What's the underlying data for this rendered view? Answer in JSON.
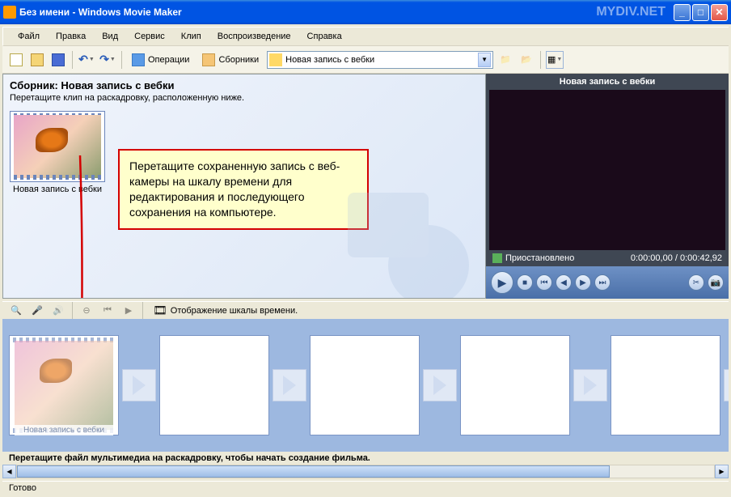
{
  "window": {
    "title": "Без имени - Windows Movie Maker",
    "watermark": "MYDIV.NET"
  },
  "menu": [
    "Файл",
    "Правка",
    "Вид",
    "Сервис",
    "Клип",
    "Воспроизведение",
    "Справка"
  ],
  "toolbar": {
    "tasks": "Операции",
    "collections": "Сборники",
    "dropdown_value": "Новая запись с вебки"
  },
  "collection": {
    "title": "Сборник: Новая запись с вебки",
    "subtitle": "Перетащите клип на раскадровку, расположенную ниже.",
    "clip_name": "Новая запись с вебки"
  },
  "hint": "Перетащите сохраненную запись с веб-камеры на шкалу времени для редактирования и последующего сохранения на компьютере.",
  "preview": {
    "title": "Новая запись с вебки",
    "status": "Приостановлено",
    "time": "0:00:00,00 / 0:00:42,92"
  },
  "timeline": {
    "toggle": "Отображение шкалы времени.",
    "clip_name": "Новая запись с вебки",
    "hint": "Перетащите файл мультимедиа на раскадровку, чтобы начать создание фильма."
  },
  "status": "Готово"
}
